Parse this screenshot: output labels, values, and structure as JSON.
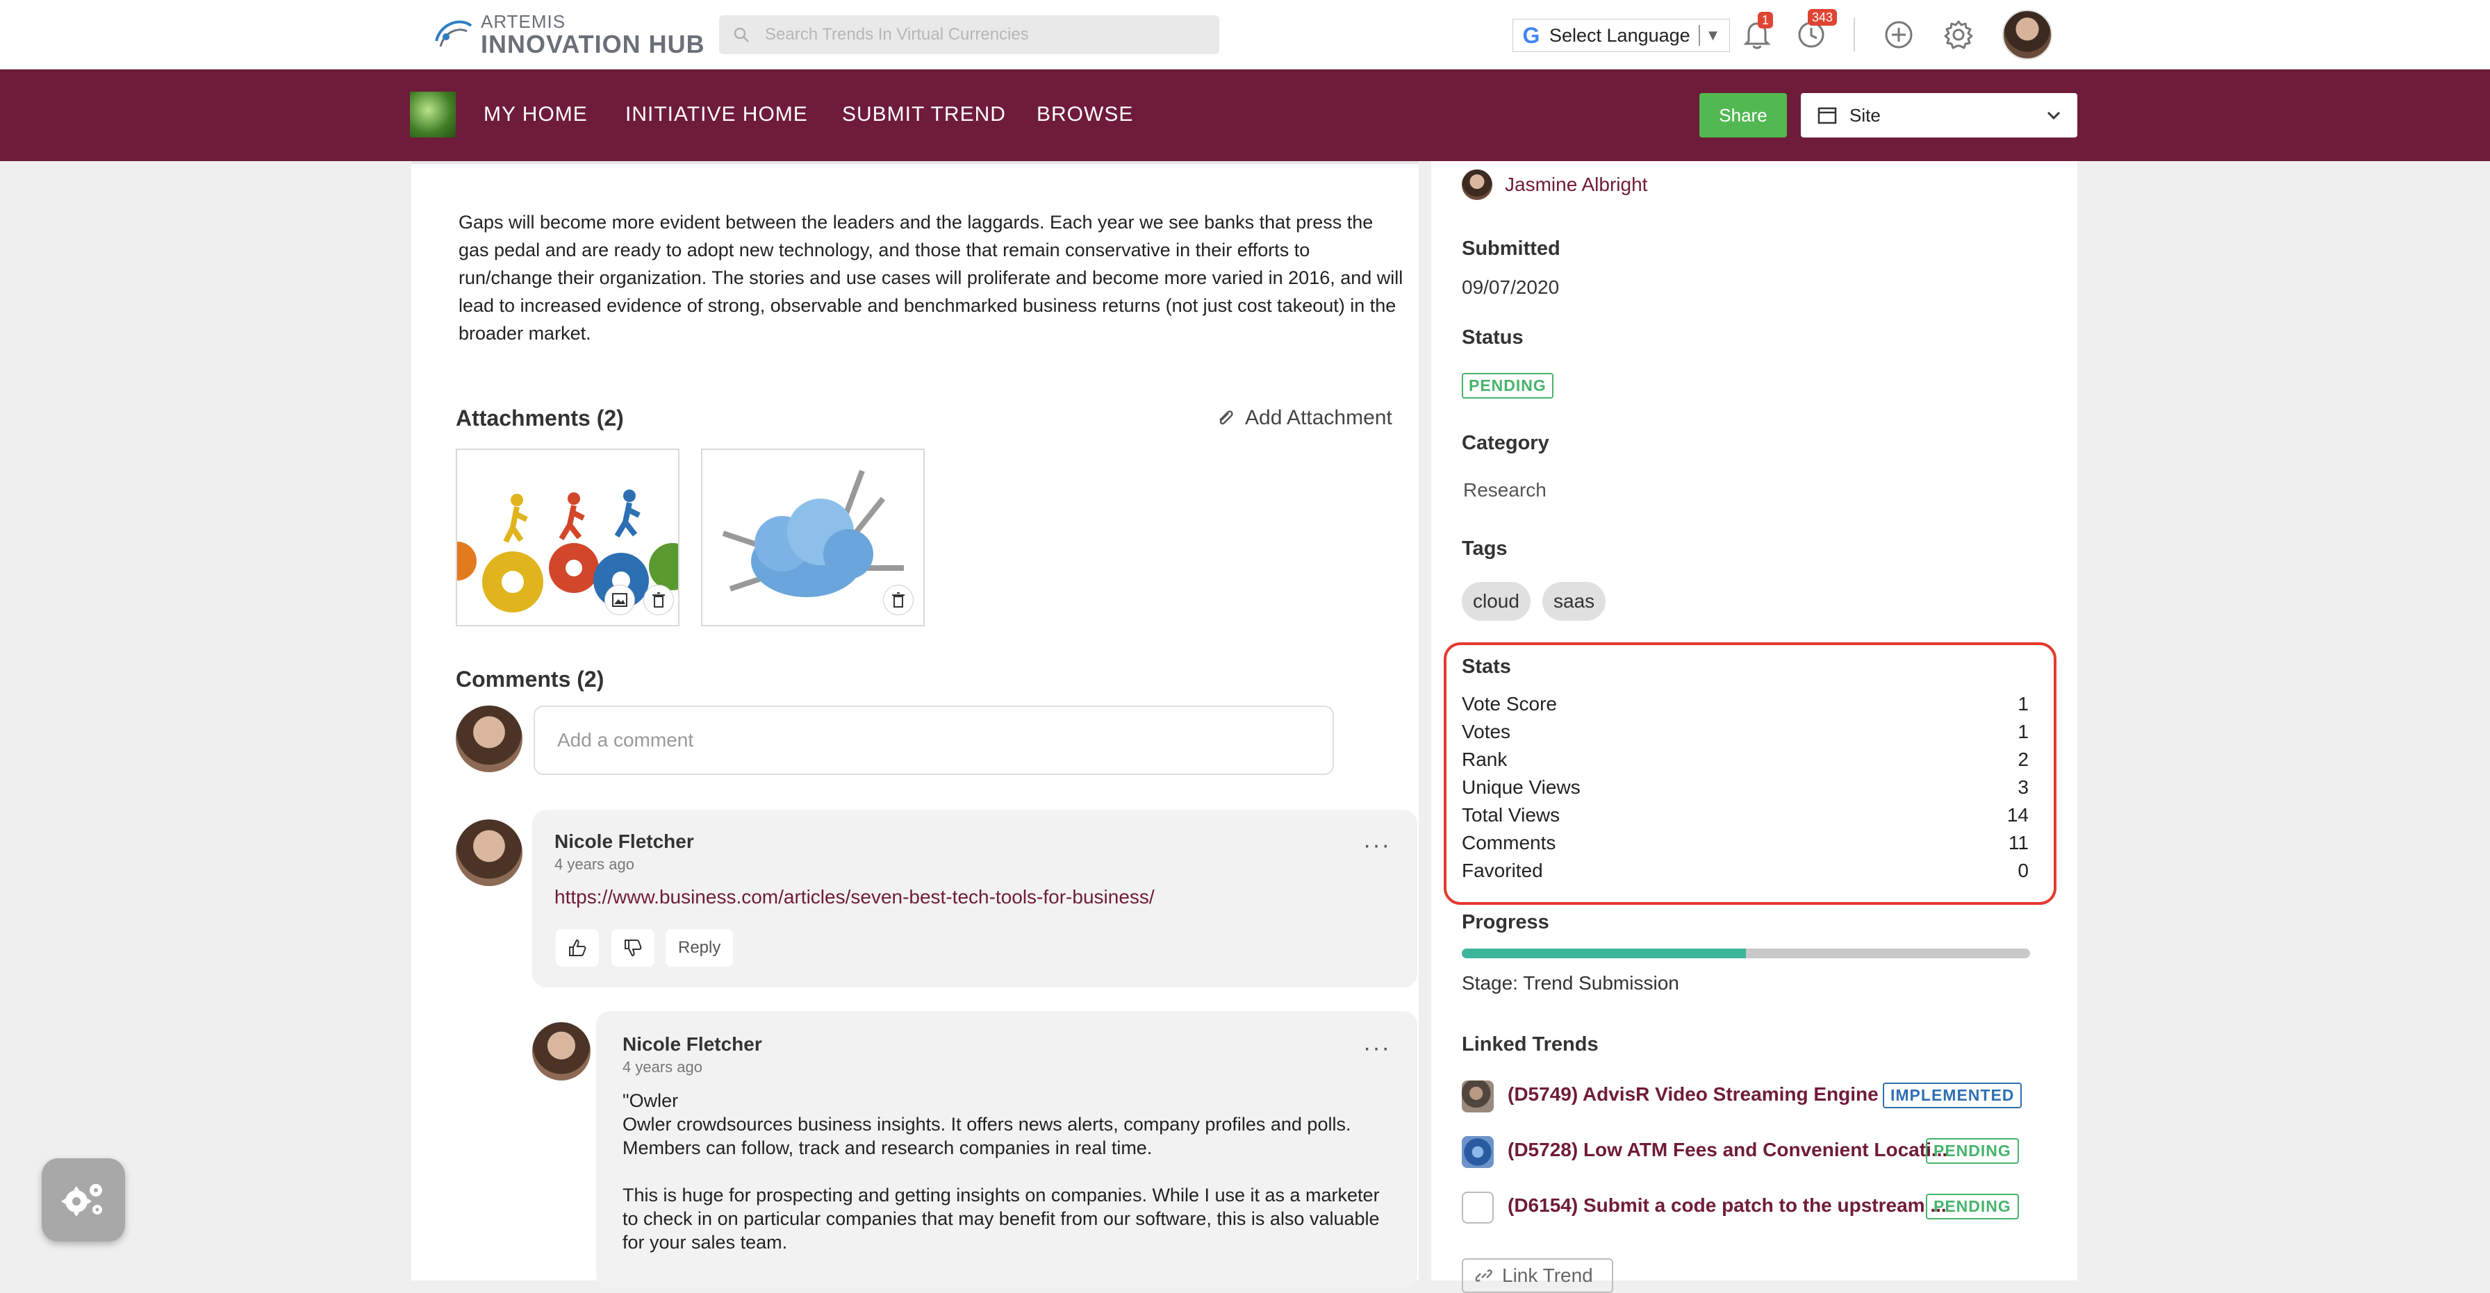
{
  "header": {
    "logo_line1": "ARTEMIS",
    "logo_line2": "INNOVATION HUB",
    "search_placeholder": "Search Trends In Virtual Currencies",
    "language_label": "Select Language",
    "notifications_count": "1",
    "activity_count": "343"
  },
  "nav": {
    "items": [
      "MY HOME",
      "INITIATIVE HOME",
      "SUBMIT TREND",
      "BROWSE"
    ],
    "share_label": "Share",
    "site_label": "Site"
  },
  "trend": {
    "description": "Gaps will become more evident between the leaders and the laggards. Each year we see banks that press the gas pedal and are ready to adopt new technology, and those that remain conservative in their efforts to run/change their organization. The stories and use cases will proliferate and become more varied in 2016, and will lead to increased evidence of strong, observable and benchmarked business returns (not just cost takeout) in the broader market.",
    "attachments_title": "Attachments (2)",
    "add_attachment": "Add Attachment",
    "comments_title": "Comments (2)",
    "comment_placeholder": "Add a comment"
  },
  "comments": [
    {
      "author": "Nicole Fletcher",
      "time": "4 years ago",
      "link": "https://www.business.com/articles/seven-best-tech-tools-for-business/",
      "reply_label": "Reply"
    },
    {
      "author": "Nicole Fletcher",
      "time": "4 years ago",
      "line1": "\"Owler",
      "line2": "Owler crowdsources business insights. It offers news alerts, company profiles and polls.",
      "line3": "Members can follow, track and research companies in real time.",
      "line4": "This is huge for prospecting and getting insights on companies. While I use it as a marketer",
      "line5": "to check in on particular companies that may benefit from our software, this is also valuable",
      "line6": "for your sales team."
    }
  ],
  "sidebar": {
    "author": "Jasmine Albright",
    "submitted_label": "Submitted",
    "submitted_value": "09/07/2020",
    "status_label": "Status",
    "status_value": "PENDING",
    "category_label": "Category",
    "category_value": "Research",
    "tags_label": "Tags",
    "tags": [
      "cloud",
      "saas"
    ],
    "stats_label": "Stats",
    "stats": [
      {
        "label": "Vote Score",
        "value": "1"
      },
      {
        "label": "Votes",
        "value": "1"
      },
      {
        "label": "Rank",
        "value": "2"
      },
      {
        "label": "Unique Views",
        "value": "3"
      },
      {
        "label": "Total Views",
        "value": "14"
      },
      {
        "label": "Comments",
        "value": "11"
      },
      {
        "label": "Favorited",
        "value": "0"
      }
    ],
    "progress_label": "Progress",
    "progress_fraction": 0.5,
    "stage_text": "Stage: Trend Submission",
    "linked_label": "Linked Trends",
    "linked": [
      {
        "title": "(D5749) AdvisR Video Streaming Engine",
        "status": "IMPLEMENTED",
        "status_color": "#2f6fb3"
      },
      {
        "title": "(D5728) Low ATM Fees and Convenient Locati...",
        "status": "PENDING",
        "status_color": "#46b46c"
      },
      {
        "title": "(D6154) Submit a code patch to the upstream ...",
        "status": "PENDING",
        "status_color": "#46b46c"
      }
    ],
    "link_trend_label": "Link Trend"
  },
  "colors": {
    "brand": "#6f1b3a",
    "share_green": "#52b852",
    "progress": "#3db59a",
    "highlight": "#e53a2e"
  }
}
